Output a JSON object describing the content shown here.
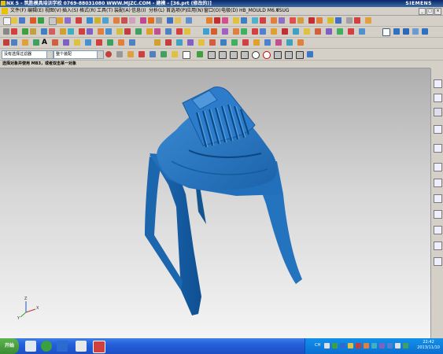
{
  "window": {
    "title": "NX 5 - 筑胜模具培训学校  0769-88031080  WWW.MJZC.COM - 建模 - [36.prt (修改的)]",
    "brand": "SIEMENS"
  },
  "menu": [
    {
      "label": "文件(F)"
    },
    {
      "label": "编辑(E)"
    },
    {
      "label": "视图(V)"
    },
    {
      "label": "插入(S)"
    },
    {
      "label": "格式(R)"
    },
    {
      "label": "工具(T)"
    },
    {
      "label": "装配(A)"
    },
    {
      "label": "信息(I)"
    },
    {
      "label": "分析(L)"
    },
    {
      "label": "首选项(P)"
    },
    {
      "label": "应用(N)"
    },
    {
      "label": "窗口(O)"
    },
    {
      "label": "电极(D)"
    },
    {
      "label": "HB_MOULD M6.6"
    },
    {
      "label": "YSUG"
    }
  ],
  "filters": {
    "type_filter": "没有选择过滤器",
    "scope": "整个装配"
  },
  "cue_line": "选择对象并使用 MB3，或者双击某一对象",
  "model": {
    "color": "#1f6fb8",
    "description": "stool"
  },
  "taskbar": {
    "start_label": "开始",
    "lang": "CH",
    "time": "22:42",
    "date": "2013/11/10"
  },
  "colors": {
    "accent": "#1f6fb8",
    "title": "#0a246a",
    "taskbar": "#245edb"
  }
}
